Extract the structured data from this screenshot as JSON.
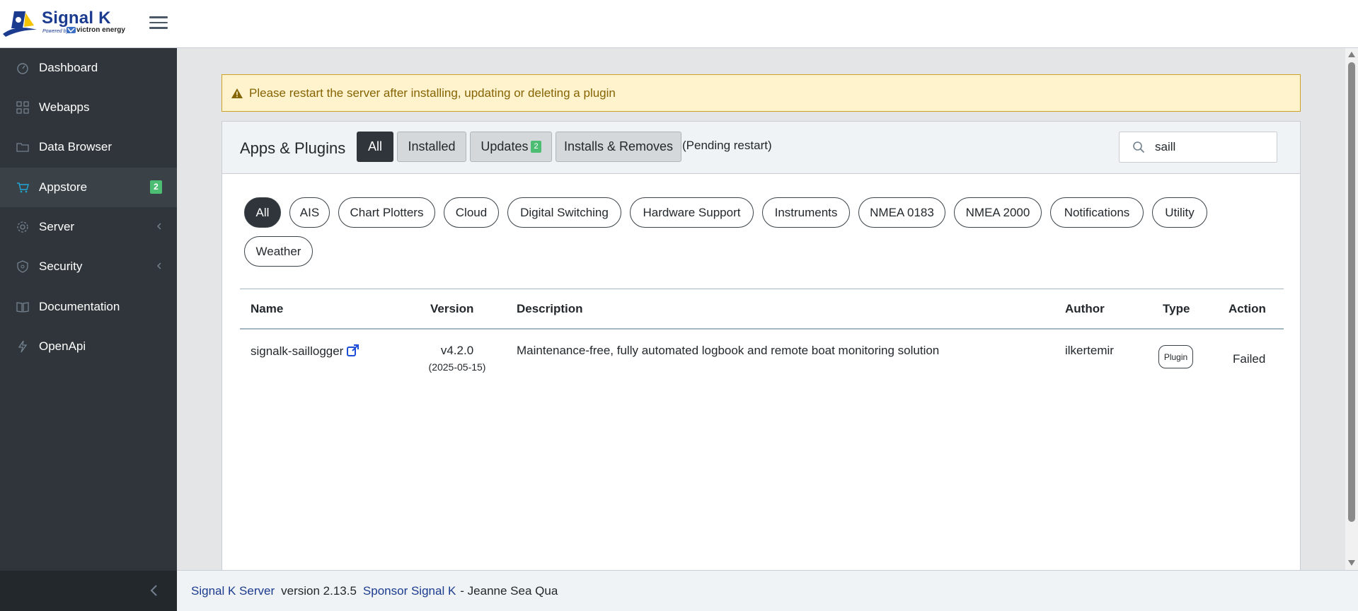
{
  "header": {
    "brand": "Signal K",
    "powered_by": "Powered by",
    "partner": "victron energy"
  },
  "sidebar": {
    "items": [
      {
        "label": "Dashboard",
        "icon": "speedometer-icon"
      },
      {
        "label": "Webapps",
        "icon": "grid-icon"
      },
      {
        "label": "Data Browser",
        "icon": "folder-icon"
      },
      {
        "label": "Appstore",
        "icon": "basket-icon",
        "badge": "2"
      },
      {
        "label": "Server",
        "icon": "gear-icon"
      },
      {
        "label": "Security",
        "icon": "shield-icon"
      },
      {
        "label": "Documentation",
        "icon": "book-icon"
      },
      {
        "label": "OpenApi",
        "icon": "bolt-icon"
      }
    ]
  },
  "alert": {
    "text": "Please restart the server after installing, updating or deleting a plugin"
  },
  "card": {
    "title": "Apps & Plugins",
    "tabs": {
      "all": "All",
      "installed": "Installed",
      "updates": "Updates",
      "updates_badge": "2",
      "installs": "Installs & Removes"
    },
    "pending": "(Pending restart)",
    "search": {
      "value": "saill"
    }
  },
  "categories": [
    "All",
    "AIS",
    "Chart Plotters",
    "Cloud",
    "Digital Switching",
    "Hardware Support",
    "Instruments",
    "NMEA 0183",
    "NMEA 2000",
    "Notifications",
    "Utility",
    "Weather"
  ],
  "table": {
    "headers": {
      "name": "Name",
      "version": "Version",
      "description": "Description",
      "author": "Author",
      "type": "Type",
      "action": "Action"
    },
    "rows": [
      {
        "name": "signalk-saillogger",
        "version": "v4.2.0",
        "date": "(2025-05-15)",
        "description": "Maintenance-free, fully automated logbook and remote boat monitoring solution",
        "author": "ilkertemir",
        "type": "Plugin",
        "action": "Failed"
      }
    ]
  },
  "footer": {
    "server_link": "Signal K Server",
    "version": "version 2.13.5",
    "sponsor_link": "Sponsor Signal K",
    "sponsor_text": "- Jeanne Sea Qua"
  },
  "colors": {
    "sidebar_bg": "#2f353a",
    "brand_blue": "#1b3b8f",
    "badge_green": "#4dbd74",
    "alert_bg": "#fff3cd"
  }
}
